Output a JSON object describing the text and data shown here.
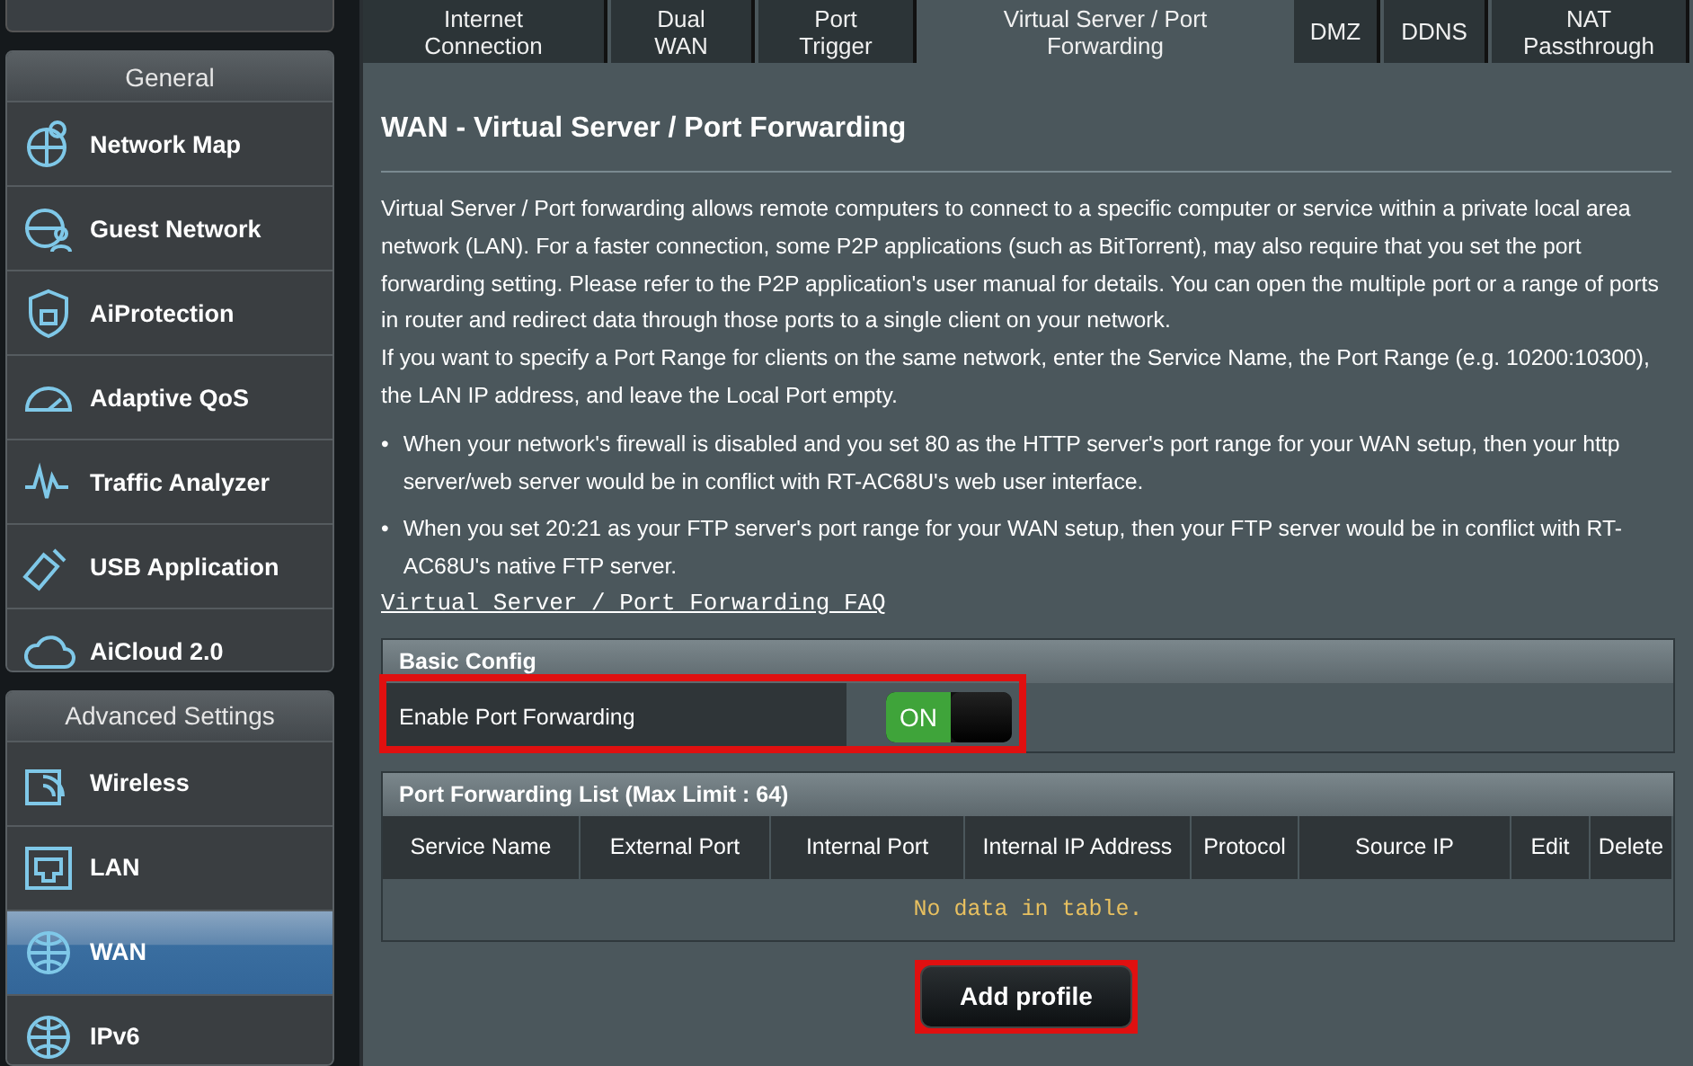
{
  "sidebar": {
    "sections": [
      {
        "title": "General",
        "items": [
          {
            "label": "Network Map",
            "kind": "map",
            "selected": false
          },
          {
            "label": "Guest Network",
            "kind": "guest",
            "selected": false
          },
          {
            "label": "AiProtection",
            "kind": "shield",
            "selected": false
          },
          {
            "label": "Adaptive QoS",
            "kind": "gauge",
            "selected": false
          },
          {
            "label": "Traffic Analyzer",
            "kind": "wave",
            "selected": false
          },
          {
            "label": "USB Application",
            "kind": "usb",
            "selected": false
          },
          {
            "label": "AiCloud 2.0",
            "kind": "cloud",
            "selected": false
          }
        ]
      },
      {
        "title": "Advanced Settings",
        "items": [
          {
            "label": "Wireless",
            "kind": "wifi",
            "selected": false
          },
          {
            "label": "LAN",
            "kind": "lan",
            "selected": false
          },
          {
            "label": "WAN",
            "kind": "globe",
            "selected": true
          },
          {
            "label": "IPv6",
            "kind": "ipv6",
            "selected": false
          }
        ]
      }
    ]
  },
  "tabs": [
    {
      "label": "Internet Connection",
      "selected": false
    },
    {
      "label": "Dual WAN",
      "selected": false
    },
    {
      "label": "Port Trigger",
      "selected": false
    },
    {
      "label": "Virtual Server / Port Forwarding",
      "selected": true
    },
    {
      "label": "DMZ",
      "selected": false
    },
    {
      "label": "DDNS",
      "selected": false
    },
    {
      "label": "NAT Passthrough",
      "selected": false
    }
  ],
  "page_title": "WAN - Virtual Server / Port Forwarding",
  "description": [
    "Virtual Server / Port forwarding allows remote computers to connect to a specific computer or service within a private local area network (LAN). For a faster connection, some P2P applications (such as BitTorrent), may also require that you set the port forwarding setting. Please refer to the P2P application's user manual for details. You can open the multiple port or a range of ports in router and redirect data through those ports to a single client on your network.",
    "If you want to specify a Port Range for clients on the same network, enter the Service Name, the Port Range (e.g. 10200:10300), the LAN IP address, and leave the Local Port empty."
  ],
  "note_bullet": "•",
  "notes": [
    "When your network's firewall is disabled and you set 80 as the HTTP server's port range for your WAN setup, then your http server/web server would be in conflict with RT-AC68U's web user interface.",
    "When you set 20:21 as your FTP server's port range for your WAN setup, then your FTP server would be in conflict with RT-AC68U's native FTP server."
  ],
  "faq_link": "Virtual Server / Port Forwarding FAQ",
  "basic_config": {
    "title": "Basic Config",
    "label": "Enable Port Forwarding",
    "toggle": {
      "on": true,
      "text": "ON"
    },
    "highlighted": true
  },
  "list": {
    "title": "Port Forwarding List (Max Limit : 64)",
    "columns": [
      "Service Name",
      "External Port",
      "Internal Port",
      "Internal IP Address",
      "Protocol",
      "Source IP",
      "Edit",
      "Delete"
    ],
    "empty_text": "No data in table."
  },
  "add_button": {
    "label": "Add profile",
    "highlighted": true
  }
}
